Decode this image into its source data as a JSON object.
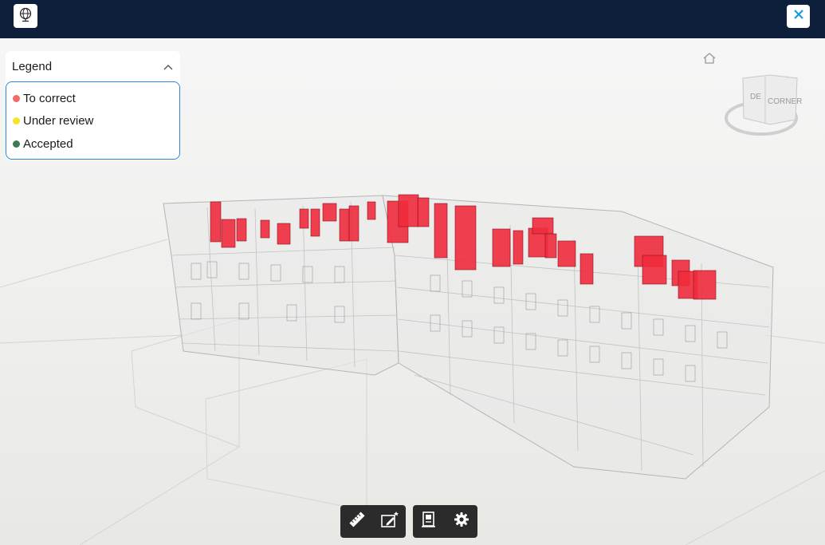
{
  "topbar": {
    "globe_icon": "globe-icon",
    "close_icon": "close-icon",
    "accent": "#1a9be0"
  },
  "legend": {
    "title": "Legend",
    "items": [
      {
        "label": "To correct",
        "color": "#f06a6a"
      },
      {
        "label": "Under review",
        "color": "#f2e52c"
      },
      {
        "label": "Accepted",
        "color": "#3f7a52"
      }
    ]
  },
  "viewcube": {
    "face_front": "CORNER",
    "face_left": "DE"
  },
  "toolbar": {
    "groups": [
      {
        "tools": [
          "ruler-icon",
          "markup-icon"
        ]
      },
      {
        "tools": [
          "sheets-icon",
          "settings-icon"
        ]
      }
    ]
  },
  "model": {
    "highlight_color": "#ef2b3c"
  }
}
